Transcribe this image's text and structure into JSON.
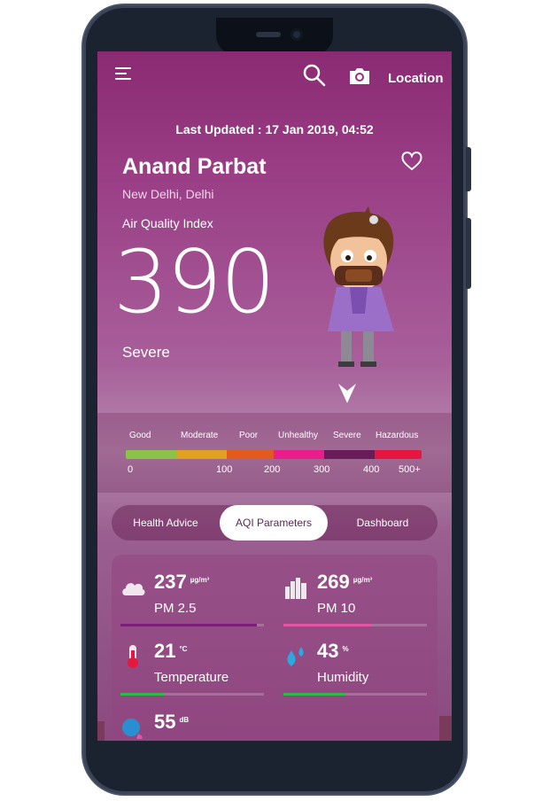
{
  "header": {
    "location_label": "Location"
  },
  "last_updated": "Last Updated : 17 Jan 2019, 04:52",
  "place": {
    "name": "Anand Parbat",
    "city": "New Delhi, Delhi"
  },
  "aqi": {
    "label": "Air Quality Index",
    "value": "390",
    "status": "Severe"
  },
  "scale": {
    "categories": [
      {
        "label": "Good",
        "color": "#8bc34a"
      },
      {
        "label": "Moderate",
        "color": "#e0a020"
      },
      {
        "label": "Poor",
        "color": "#e35a1e"
      },
      {
        "label": "Unhealthy",
        "color": "#e91e8c"
      },
      {
        "label": "Severe",
        "color": "#6a1b5a"
      },
      {
        "label": "Hazardous",
        "color": "#e5173f"
      }
    ],
    "ticks": [
      "0",
      "100",
      "200",
      "300",
      "400",
      "500+"
    ]
  },
  "tabs": [
    {
      "label": "Health Advice",
      "active": false
    },
    {
      "label": "AQI Parameters",
      "active": true
    },
    {
      "label": "Dashboard",
      "active": false
    }
  ],
  "params": [
    {
      "icon": "cloud-icon",
      "value": "237",
      "unit": "µg/m³",
      "name": "PM 2.5",
      "color": "#7a1f78",
      "fill": 0.95
    },
    {
      "icon": "buildings-icon",
      "value": "269",
      "unit": "µg/m³",
      "name": "PM 10",
      "color": "#e255a5",
      "fill": 0.62
    },
    {
      "icon": "thermometer-icon",
      "value": "21",
      "unit": "°C",
      "name": "Temperature",
      "color": "#2eb84a",
      "fill": 0.3
    },
    {
      "icon": "water-drops-icon",
      "value": "43",
      "unit": "%",
      "name": "Humidity",
      "color": "#2eb84a",
      "fill": 0.43
    },
    {
      "icon": "noise-icon",
      "value": "55",
      "unit": "dB",
      "name": "",
      "color": "#2eb84a",
      "fill": 0.5
    }
  ]
}
